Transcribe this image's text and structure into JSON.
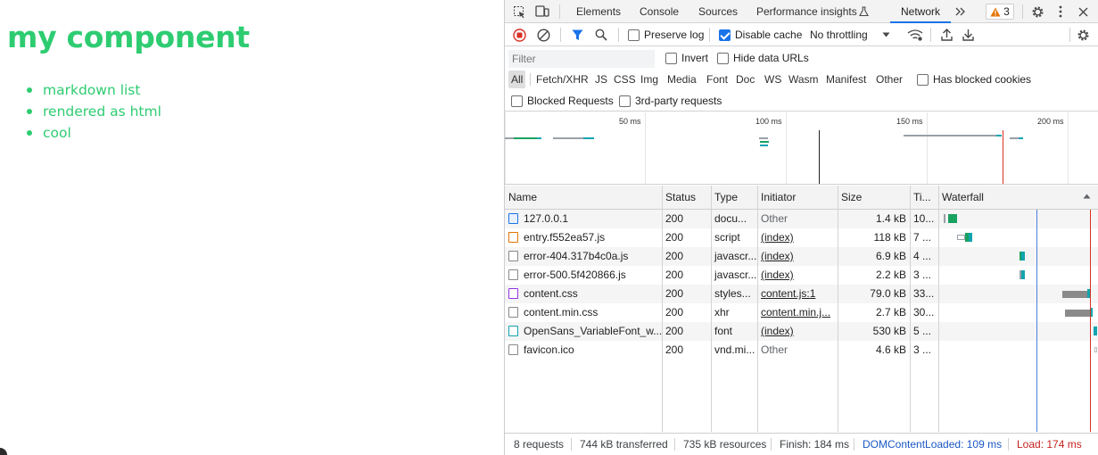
{
  "page": {
    "heading": "my component",
    "list": [
      "markdown list",
      "rendered as html",
      "cool"
    ],
    "accent_color": "#2ecc71"
  },
  "devtools": {
    "tabs": [
      "Elements",
      "Console",
      "Sources",
      "Performance insights",
      "Network"
    ],
    "active_tab": "Network",
    "more_tabs_icon": "chevron-double-right-icon",
    "warning_count": "3",
    "toolbar": {
      "preserve_log": "Preserve log",
      "preserve_log_checked": false,
      "disable_cache": "Disable cache",
      "disable_cache_checked": true,
      "throttling": "No throttling"
    },
    "filter": {
      "placeholder": "Filter",
      "invert": "Invert",
      "hide_data_urls": "Hide data URLs"
    },
    "types": [
      "All",
      "Fetch/XHR",
      "JS",
      "CSS",
      "Img",
      "Media",
      "Font",
      "Doc",
      "WS",
      "Wasm",
      "Manifest",
      "Other"
    ],
    "active_type": "All",
    "has_blocked_cookies": "Has blocked cookies",
    "blocked_requests": "Blocked Requests",
    "third_party": "3rd-party requests",
    "overview_ticks": [
      "50 ms",
      "100 ms",
      "150 ms",
      "200 ms"
    ],
    "columns": [
      "Name",
      "Status",
      "Type",
      "Initiator",
      "Size",
      "Ti...",
      "Waterfall"
    ],
    "rows": [
      {
        "name": "127.0.0.1",
        "status": "200",
        "type": "docu...",
        "initiator": "Other",
        "size": "1.4 kB",
        "time": "10...",
        "icon": "document-icon"
      },
      {
        "name": "entry.f552ea57.js",
        "status": "200",
        "type": "script",
        "initiator": "(index)",
        "size": "118 kB",
        "time": "7 ...",
        "icon": "script-icon"
      },
      {
        "name": "error-404.317b4c0a.js",
        "status": "200",
        "type": "javascr...",
        "initiator": "(index)",
        "size": "6.9 kB",
        "time": "4 ...",
        "icon": "file-icon"
      },
      {
        "name": "error-500.5f420866.js",
        "status": "200",
        "type": "javascr...",
        "initiator": "(index)",
        "size": "2.2 kB",
        "time": "3 ...",
        "icon": "file-icon"
      },
      {
        "name": "content.css",
        "status": "200",
        "type": "styles...",
        "initiator": "content.js:1",
        "size": "79.0 kB",
        "time": "33...",
        "icon": "stylesheet-icon"
      },
      {
        "name": "content.min.css",
        "status": "200",
        "type": "xhr",
        "initiator": "content.min.j...",
        "size": "2.7 kB",
        "time": "30...",
        "icon": "file-icon"
      },
      {
        "name": "OpenSans_VariableFont_w...",
        "status": "200",
        "type": "font",
        "initiator": "(index)",
        "size": "530 kB",
        "time": "5 ...",
        "icon": "font-icon"
      },
      {
        "name": "favicon.ico",
        "status": "200",
        "type": "vnd.mi...",
        "initiator": "Other",
        "size": "4.6 kB",
        "time": "3 ...",
        "icon": "file-icon"
      }
    ],
    "status": {
      "requests": "8 requests",
      "transferred": "744 kB transferred",
      "resources": "735 kB resources",
      "finish": "Finish: 184 ms",
      "dom_content_loaded": "DOMContentLoaded: 109 ms",
      "load": "Load: 174 ms"
    },
    "colors": {
      "dcl_line": "#4a7fe0",
      "load_line": "#d93025",
      "active_blue": "#1a73e8"
    }
  }
}
